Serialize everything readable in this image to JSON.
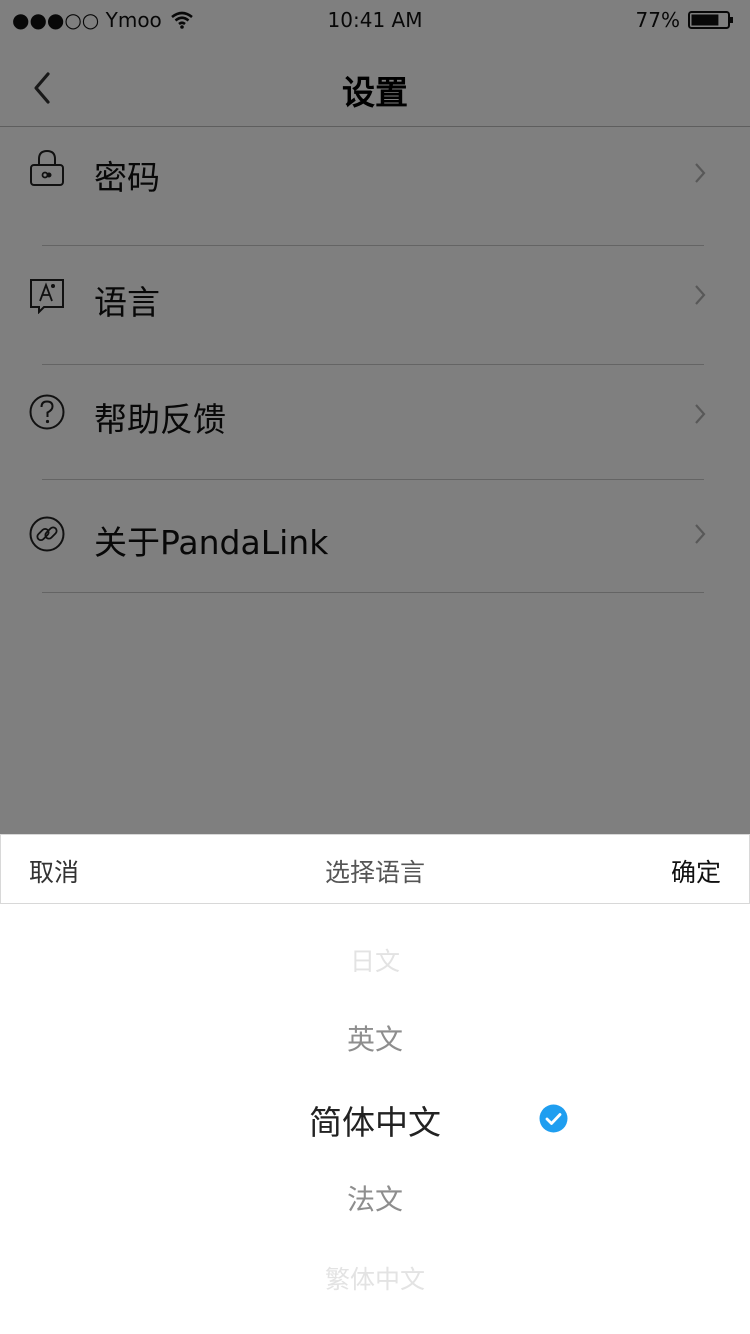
{
  "status_bar": {
    "carrier": "●●●○○ Ymoo",
    "time": "10:41 AM",
    "battery": "77%",
    "battery_level": 0.77
  },
  "nav": {
    "title": "设置",
    "back_icon": "chevron-left-icon"
  },
  "settings": {
    "items": [
      {
        "label": "密码",
        "icon": "lock-icon"
      },
      {
        "label": "语言",
        "icon": "language-icon"
      },
      {
        "label": "帮助反馈",
        "icon": "help-icon"
      },
      {
        "label": "关于PandaLink",
        "icon": "link-icon"
      }
    ]
  },
  "sheet": {
    "cancel_label": "取消",
    "title": "选择语言",
    "confirm_label": "确定",
    "options": [
      "日文",
      "英文",
      "简体中文",
      "法文",
      "繁体中文"
    ],
    "selected": "简体中文",
    "check_color": "#1f9ef0"
  }
}
